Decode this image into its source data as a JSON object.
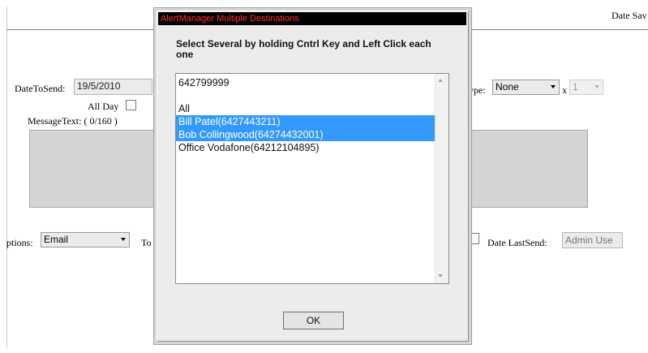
{
  "header": {
    "right_text": "Date Sav"
  },
  "form": {
    "date_to_send_label": "DateToSend:",
    "date_to_send_value": "19/5/2010",
    "all_day_label": "All Day",
    "message_text_label": "MessageText: ( 0/160 )",
    "options_label": "ptions:",
    "options_value": "Email",
    "to_label": "To",
    "type_label": "ype:",
    "type_value": "None",
    "x_label": "x",
    "x_value": "1",
    "date_last_send_label": "Date LastSend:",
    "date_last_send_placeholder": "Admin Use"
  },
  "dialog": {
    "title": "AlertManager Multiple Destinations",
    "instruction": "Select Several by holding Cntrl Key and Left Click each one",
    "items": [
      {
        "label": "642799999",
        "selected": false
      },
      {
        "label": "",
        "selected": false
      },
      {
        "label": "All",
        "selected": false
      },
      {
        "label": "Bill Patel(6427443211)",
        "selected": true
      },
      {
        "label": "Bob Collingwood(64274432001)",
        "selected": true
      },
      {
        "label": "Office Vodafone(64212104895)",
        "selected": false
      }
    ],
    "ok_label": "OK"
  },
  "colors": {
    "selection": "#3399ff",
    "title_text": "#ff3030",
    "title_bar": "#000000"
  },
  "icons": [
    "chevron-down-icon",
    "scroll-up-icon",
    "scroll-down-icon",
    "checkbox-icon"
  ]
}
